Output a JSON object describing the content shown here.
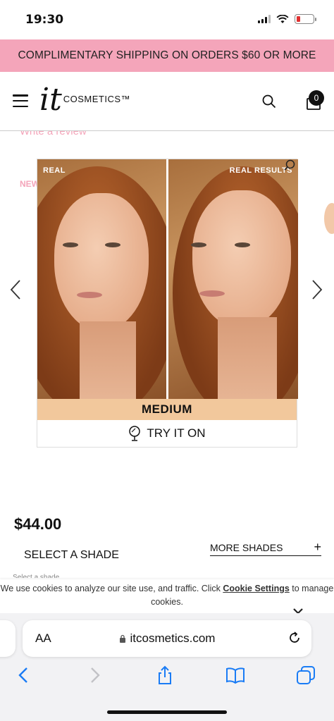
{
  "status_bar": {
    "time": "19:30",
    "battery_color": "#e03030"
  },
  "promo": {
    "text": "COMPLIMENTARY SHIPPING ON ORDERS $60 OR MORE",
    "background": "#f4a5ba"
  },
  "header": {
    "logo_it": "it",
    "logo_cosmetics": "COSMETICS™",
    "bag_count": "0"
  },
  "product": {
    "review_link": "Write a review",
    "badge": "NEW",
    "before_label": "REAL",
    "after_label": "REAL RESULTS",
    "shade_name": "MEDIUM",
    "try_on_label": "TRY IT ON",
    "price": "$44.00",
    "select_shade_label": "SELECT A SHADE",
    "more_shades_label": "MORE SHADES",
    "more_shades_icon": "+",
    "select_hint": "Select a shade"
  },
  "cookie": {
    "text_before": "We use cookies to analyze our site use, and traffic. Click ",
    "link_text": "Cookie Settings",
    "text_after": " to manage cookies."
  },
  "browser": {
    "aa_label": "AA",
    "url": "itcosmetics.com",
    "icons": [
      "back-icon",
      "forward-icon",
      "share-icon",
      "bookmarks-icon",
      "tabs-icon"
    ]
  },
  "colors": {
    "accent_pink": "#f4a5ba",
    "shade_swatch": "#f2c89c",
    "safari_blue": "#1a7cf5"
  }
}
